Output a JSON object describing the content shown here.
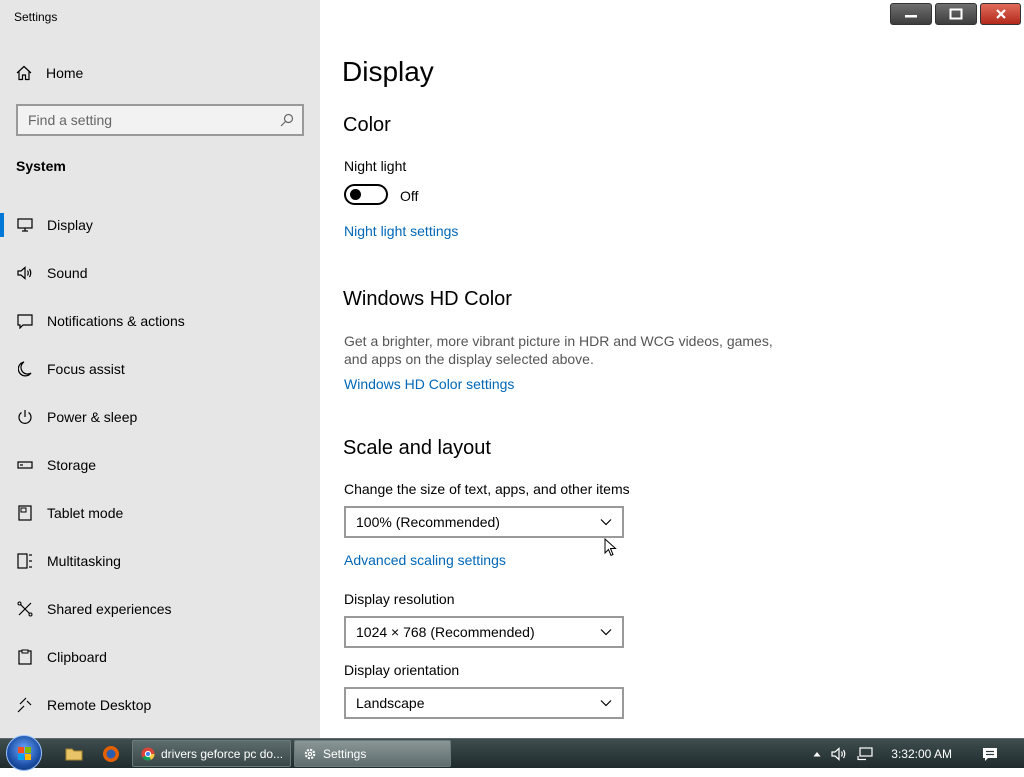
{
  "window": {
    "title": "Settings"
  },
  "sidebar": {
    "home_label": "Home",
    "search_placeholder": "Find a setting",
    "section_title": "System",
    "items": [
      {
        "label": "Display",
        "icon": "monitor-icon",
        "active": true
      },
      {
        "label": "Sound",
        "icon": "speaker-icon"
      },
      {
        "label": "Notifications & actions",
        "icon": "message-icon"
      },
      {
        "label": "Focus assist",
        "icon": "moon-icon"
      },
      {
        "label": "Power & sleep",
        "icon": "power-icon"
      },
      {
        "label": "Storage",
        "icon": "storage-icon"
      },
      {
        "label": "Tablet mode",
        "icon": "tablet-icon"
      },
      {
        "label": "Multitasking",
        "icon": "multitask-icon"
      },
      {
        "label": "Shared experiences",
        "icon": "share-icon"
      },
      {
        "label": "Clipboard",
        "icon": "clipboard-icon"
      },
      {
        "label": "Remote Desktop",
        "icon": "remote-icon"
      }
    ]
  },
  "content": {
    "title": "Display",
    "color_heading": "Color",
    "night_light_label": "Night light",
    "night_light_state": "Off",
    "night_light_link": "Night light settings",
    "hd_heading": "Windows HD Color",
    "hd_description": "Get a brighter, more vibrant picture in HDR and WCG videos, games, and apps on the display selected above.",
    "hd_link": "Windows HD Color settings",
    "scale_heading": "Scale and layout",
    "scale_label": "Change the size of text, apps, and other items",
    "scale_value": "100% (Recommended)",
    "adv_scaling_link": "Advanced scaling settings",
    "resolution_label": "Display resolution",
    "resolution_value": "1024 × 768 (Recommended)",
    "orientation_label": "Display orientation",
    "orientation_value": "Landscape"
  },
  "taskbar": {
    "buttons": [
      {
        "label": "drivers geforce pc do...",
        "icon": "chrome-icon"
      },
      {
        "label": "Settings",
        "icon": "gear-icon",
        "active": true
      }
    ],
    "clock": "3:32:00 AM"
  },
  "colors": {
    "accent": "#0078d7",
    "link": "#0067b8",
    "sidebar_bg": "#e6e6e6"
  }
}
